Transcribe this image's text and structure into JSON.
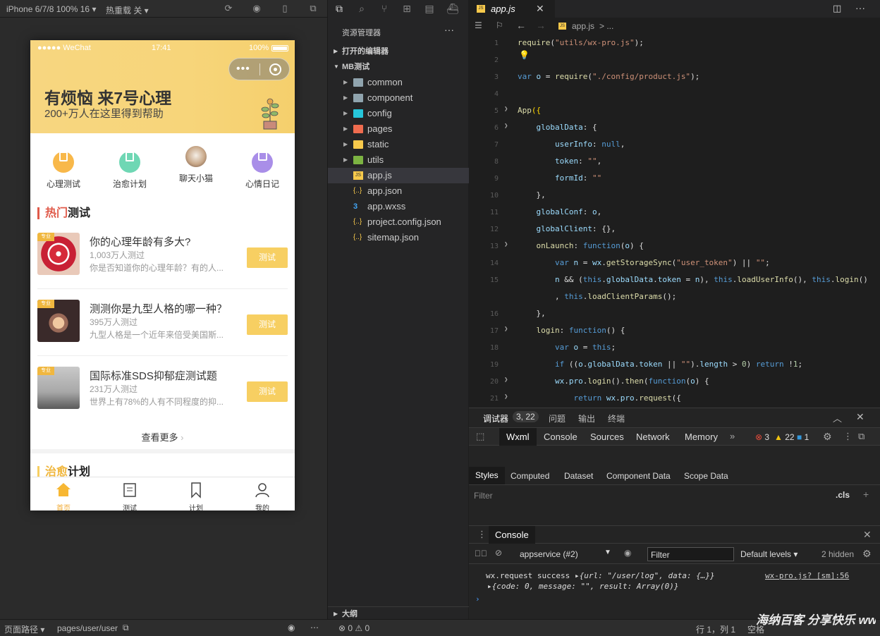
{
  "sim": {
    "device": "iPhone 6/7/8 100% 16",
    "hotreload": "热重载 关",
    "status": {
      "carrier": "●●●●● WeChat",
      "time": "17:41",
      "battery": "100%"
    },
    "banner": {
      "title": "有烦恼 来7号心理",
      "subtitle": "200+万人在这里得到帮助"
    },
    "categories": [
      "心理测试",
      "治愈计划",
      "聊天小猫",
      "心情日记"
    ],
    "hot_section": {
      "highlight": "热门",
      "rest": "测试"
    },
    "tests": [
      {
        "tag": "专业",
        "title": "你的心理年龄有多大?",
        "count": "1,003万人测过",
        "desc": "你是否知道你的心理年龄？有的人...",
        "btn": "测试"
      },
      {
        "tag": "专业",
        "title": "测测你是九型人格的哪一种？",
        "count": "395万人测过",
        "desc": "九型人格是一个近年来倍受美国斯...",
        "btn": "测试"
      },
      {
        "tag": "专业",
        "title": "国际标准SDS抑郁症测试题",
        "count": "231万人测过",
        "desc": "世界上有78%的人有不同程度的抑...",
        "btn": "测试"
      }
    ],
    "more": "查看更多",
    "heal_section": {
      "highlight": "治愈",
      "rest": "计划"
    },
    "tabbar": [
      "首页",
      "测试",
      "计划",
      "我的"
    ],
    "footer": {
      "path_label": "页面路径",
      "path": "pages/user/user"
    }
  },
  "explorer": {
    "header": "资源管理器",
    "open_editors": "打开的编辑器",
    "project": "MB测试",
    "folders": [
      "common",
      "component",
      "config",
      "pages",
      "static",
      "utils"
    ],
    "files": [
      "app.js",
      "app.json",
      "app.wxss",
      "project.config.json",
      "sitemap.json"
    ],
    "outline": "大纲"
  },
  "editor": {
    "tab": "app.js",
    "crumb": "app.js",
    "crumb_more": "> ..."
  },
  "debug": {
    "title": "调试器",
    "badge": "3, 22",
    "tabs_top": [
      "问题",
      "输出",
      "终端"
    ],
    "tabs": [
      "Wxml",
      "Console",
      "Sources",
      "Network",
      "Memory"
    ],
    "counts": {
      "errors": "3",
      "warnings": "22",
      "info": "1"
    },
    "style_tabs": [
      "Styles",
      "Computed",
      "Dataset",
      "Component Data",
      "Scope Data"
    ],
    "filter": "Filter",
    "cls": ".cls",
    "console_title": "Console",
    "context": "appservice (#2)",
    "levels": "Default levels",
    "hidden": "2 hidden",
    "log_msg": "wx.request success",
    "log_obj": "{url: \"/user/log\", data: {…}}",
    "log_src": "wx-pro.js? [sm]:56",
    "log_obj2": "{code: 0, message: \"\", result: Array(0)}"
  },
  "statusbar": {
    "errors": "0",
    "warnings": "0",
    "position": "行 1，列 1",
    "lang": "空格"
  },
  "watermark": "海纳百客 分享快乐 www.hainabaike.com"
}
